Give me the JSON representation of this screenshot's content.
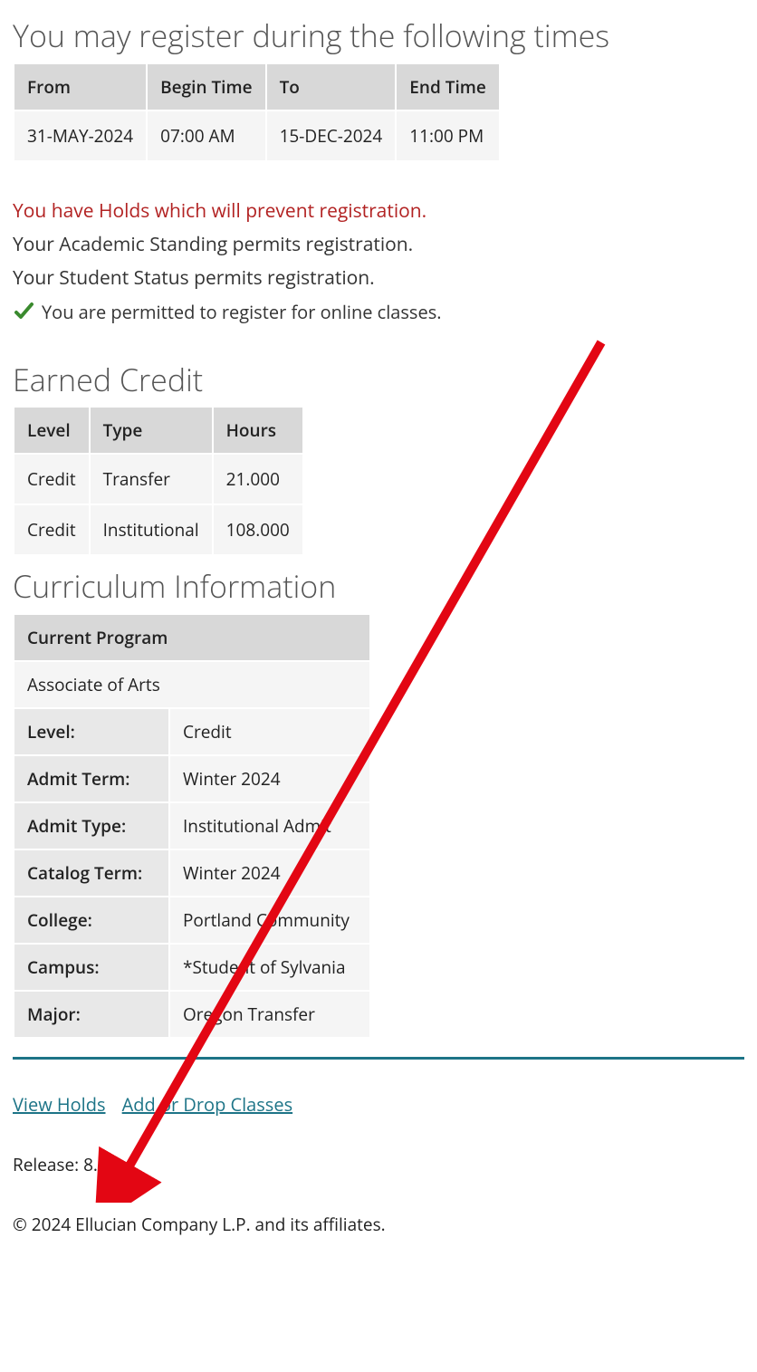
{
  "registration_times": {
    "title": "You may register during the following times",
    "headers": [
      "From",
      "Begin Time",
      "To",
      "End Time"
    ],
    "row": {
      "from": "31-MAY-2024",
      "begin_time": "07:00 AM",
      "to": "15-DEC-2024",
      "end_time": "11:00 PM"
    }
  },
  "status": {
    "holds_warning": "You have Holds which will prevent registration.",
    "academic_standing": "Your Academic Standing permits registration.",
    "student_status": "Your Student Status permits registration.",
    "online_permit": "You are permitted to register for online classes."
  },
  "earned_credit": {
    "title": "Earned Credit",
    "headers": [
      "Level",
      "Type",
      "Hours"
    ],
    "rows": [
      {
        "level": "Credit",
        "type": "Transfer",
        "hours": "21.000"
      },
      {
        "level": "Credit",
        "type": "Institutional",
        "hours": "108.000"
      }
    ]
  },
  "curriculum": {
    "title": "Curriculum Information",
    "program_header": "Current Program",
    "program_name": "Associate of Arts",
    "fields": [
      {
        "label": "Level:",
        "value": "Credit"
      },
      {
        "label": "Admit Term:",
        "value": "Winter 2024"
      },
      {
        "label": "Admit Type:",
        "value": "Institutional Admit"
      },
      {
        "label": "Catalog Term:",
        "value": "Winter 2024"
      },
      {
        "label": "College:",
        "value": "Portland Community"
      },
      {
        "label": "Campus:",
        "value": "*Student of Sylvania"
      },
      {
        "label": "Major:",
        "value": "Oregon Transfer"
      }
    ]
  },
  "links": {
    "view_holds": "View Holds",
    "add_drop": "Add or Drop Classes"
  },
  "footer": {
    "release": "Release: 8.7.1",
    "copyright": "© 2024 Ellucian Company L.P. and its affiliates."
  }
}
